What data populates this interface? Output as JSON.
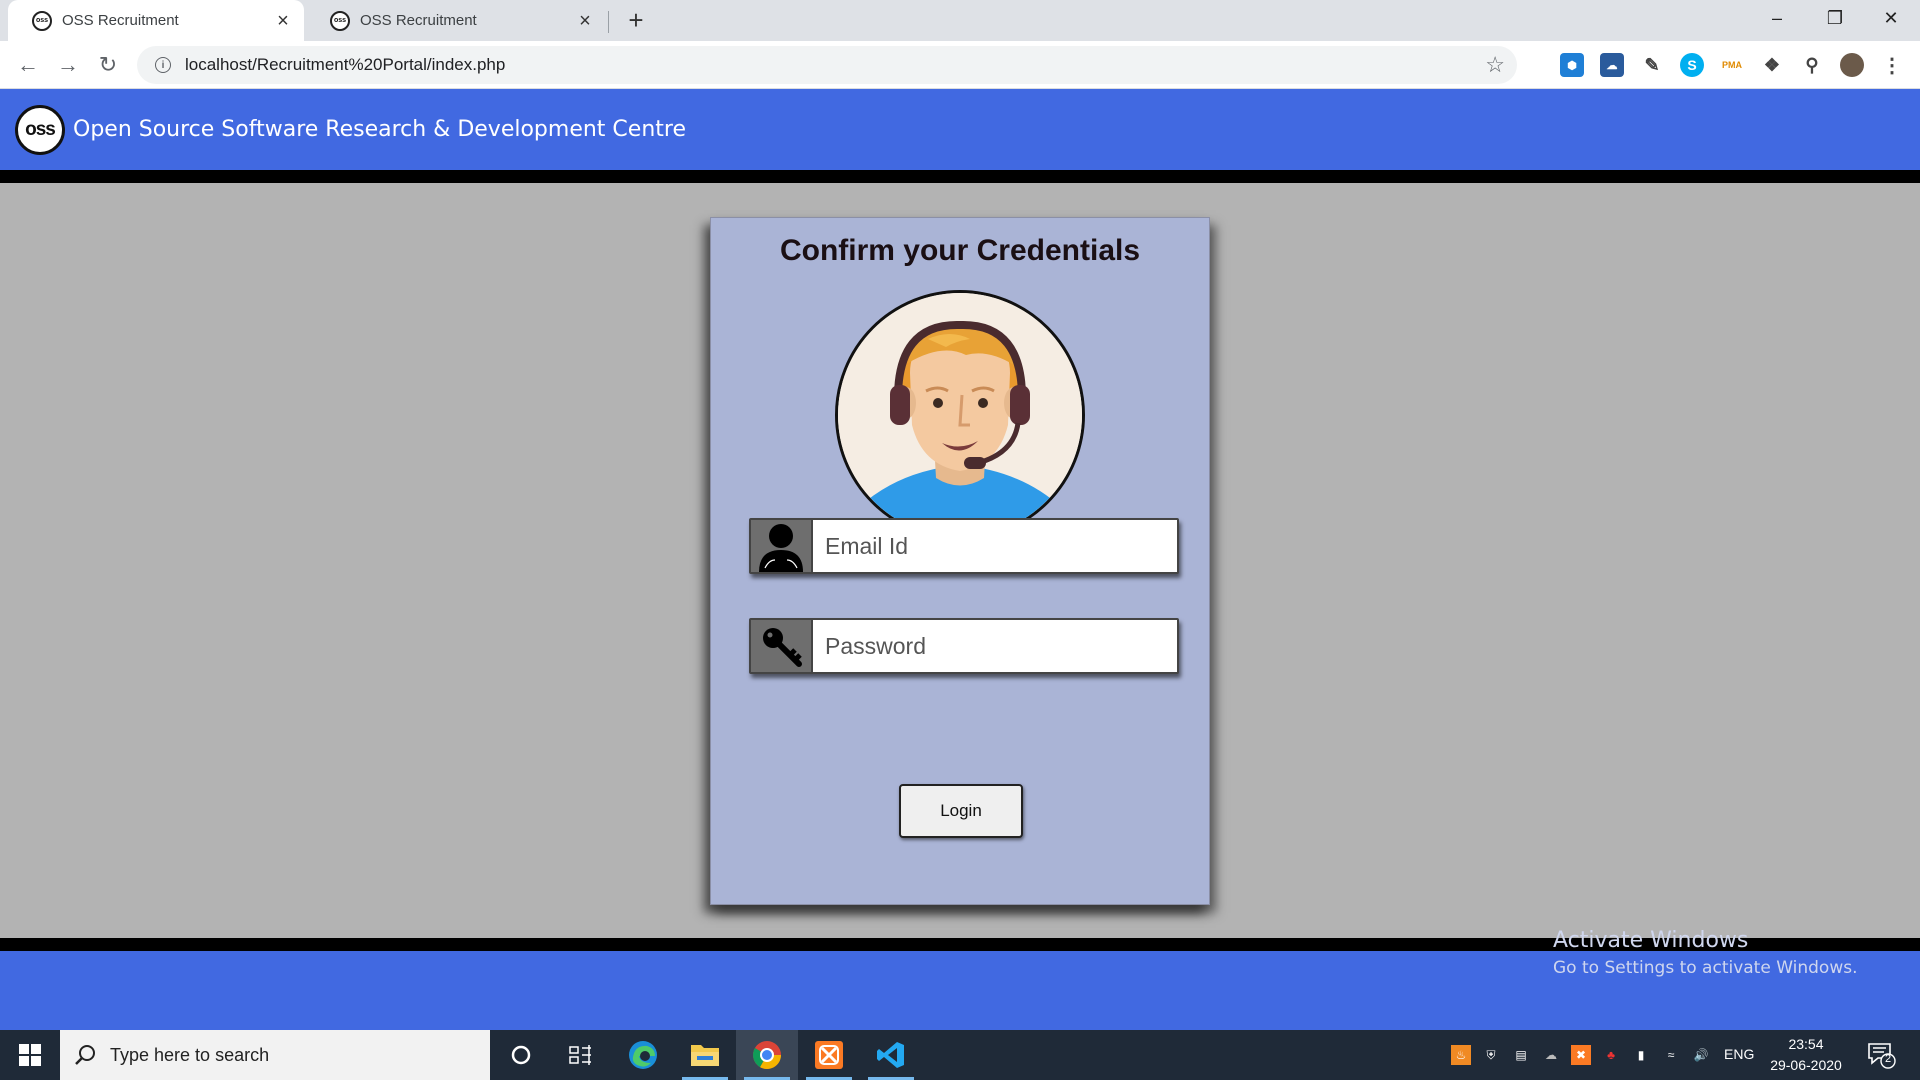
{
  "browser": {
    "tabs": [
      {
        "title": "OSS Recruitment",
        "favicon_text": "oss",
        "active": true
      },
      {
        "title": "OSS Recruitment",
        "favicon_text": "oss",
        "active": false
      }
    ],
    "url": "localhost/Recruitment%20Portal/index.php",
    "extensions": [
      "azure-devops",
      "onedrive",
      "color-picker",
      "skype",
      "phpmyadmin",
      "puzzle",
      "key"
    ]
  },
  "page": {
    "header": {
      "logo_text": "oss",
      "title": "Open Source Software Research & Development Centre"
    },
    "card": {
      "title": "Confirm your Credentials",
      "email_placeholder": "Email Id",
      "password_placeholder": "Password",
      "login_label": "Login"
    },
    "watermark": {
      "line1": "Activate Windows",
      "line2": "Go to Settings to activate Windows."
    }
  },
  "taskbar": {
    "search_placeholder": "Type here to search",
    "apps": [
      "cortana",
      "task-view",
      "edge",
      "file-explorer",
      "chrome",
      "xampp",
      "vscode"
    ],
    "language": "ENG",
    "time": "23:54",
    "date": "29-06-2020",
    "notification_count": "2"
  },
  "colors": {
    "header_blue": "#4169e1",
    "card_bg": "#aab4d6",
    "page_bg": "#b3b3b3",
    "taskbar_bg": "#1f2a38"
  }
}
